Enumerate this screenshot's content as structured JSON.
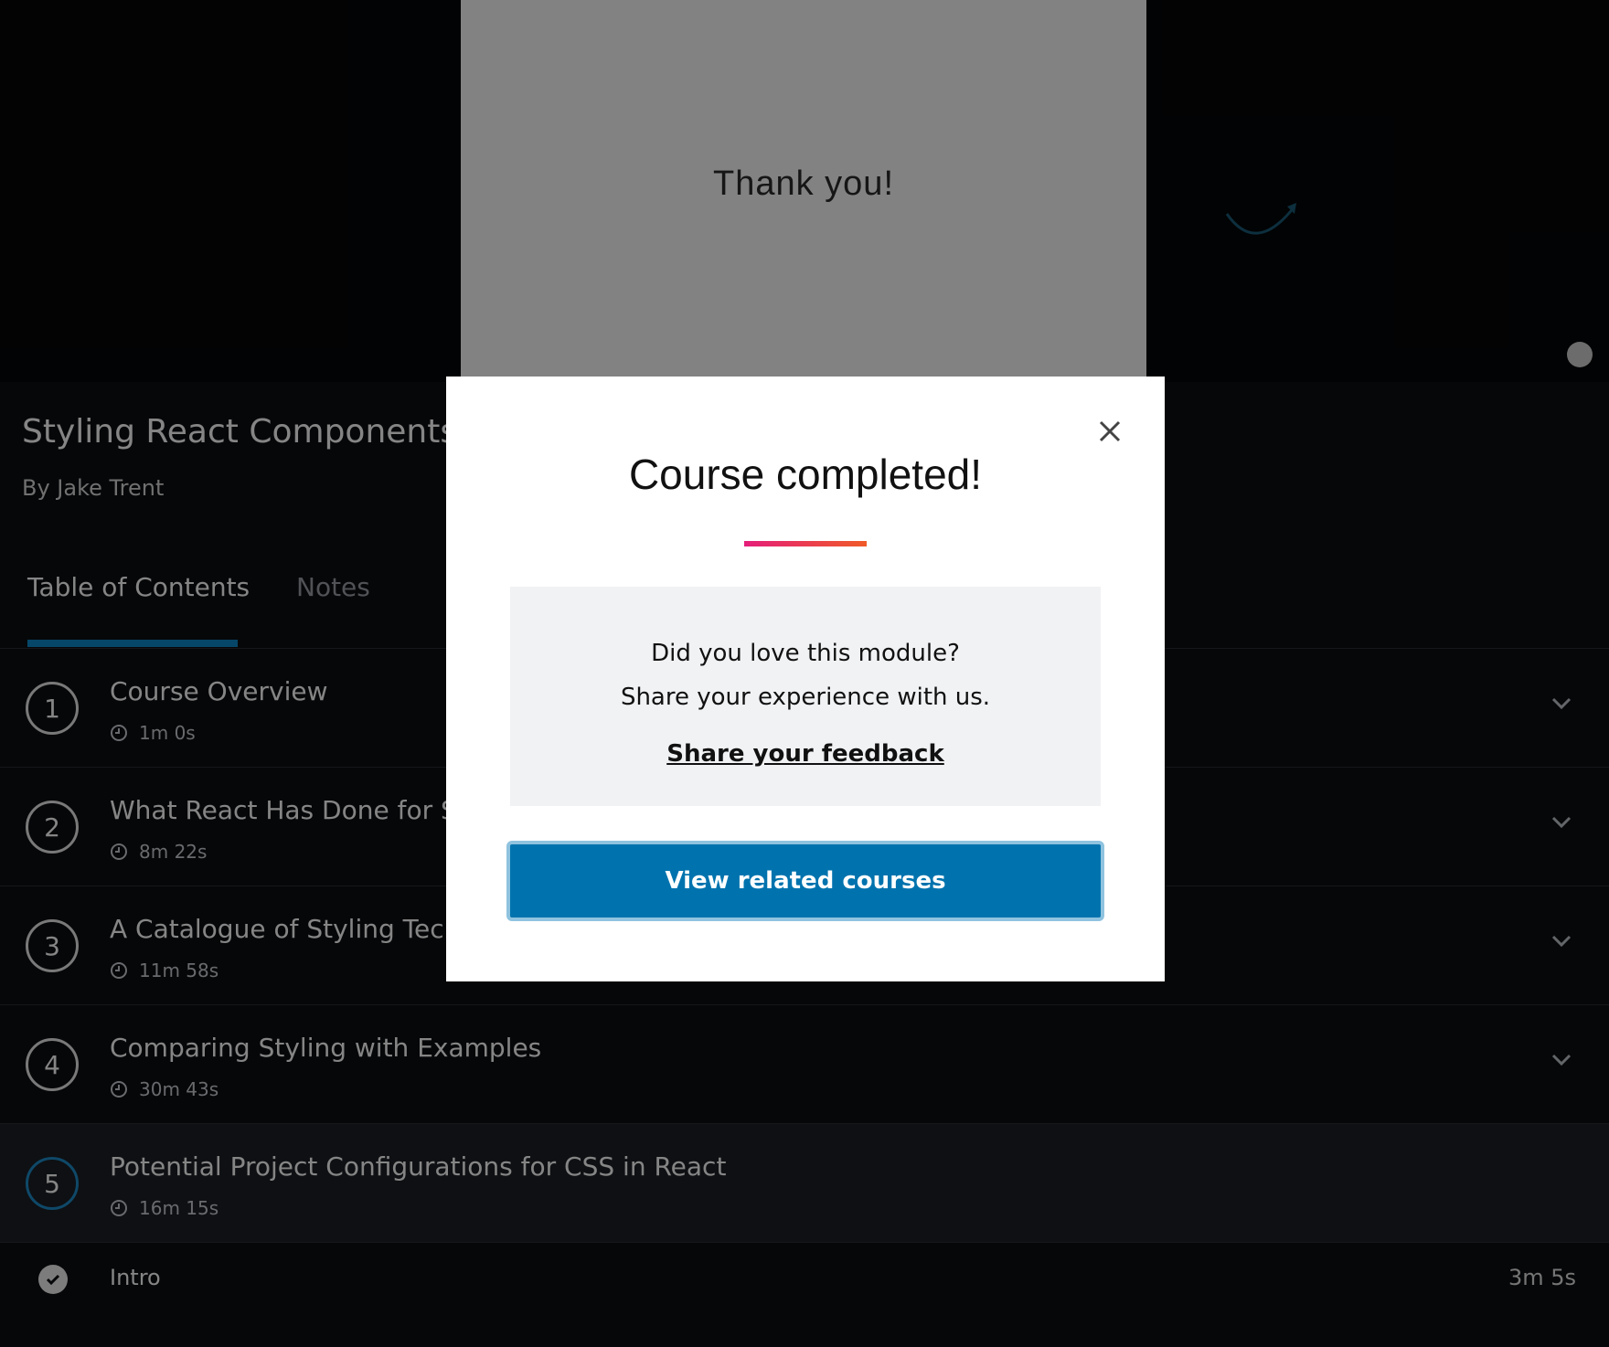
{
  "video": {
    "thanks_text": "Thank you!"
  },
  "course": {
    "title": "Styling React Components",
    "author": "By Jake Trent"
  },
  "tabs": [
    {
      "label": "Table of Contents",
      "active": true
    },
    {
      "label": "Notes",
      "active": false
    }
  ],
  "modules": [
    {
      "number": "1",
      "title": "Course Overview",
      "duration": "1m 0s",
      "active": false
    },
    {
      "number": "2",
      "title": "What React Has Done for St",
      "duration": "8m 22s",
      "active": false
    },
    {
      "number": "3",
      "title": "A Catalogue of Styling Tech",
      "duration": "11m 58s",
      "active": false
    },
    {
      "number": "4",
      "title": "Comparing Styling with Examples",
      "duration": "30m 43s",
      "active": false
    },
    {
      "number": "5",
      "title": "Potential Project Configurations for CSS in React",
      "duration": "16m 15s",
      "active": true
    }
  ],
  "clips": [
    {
      "title": "Intro",
      "duration": "3m 5s",
      "completed": true
    }
  ],
  "modal": {
    "title": "Course completed!",
    "question": "Did you love this module?",
    "share_text": "Share your experience with us.",
    "feedback_link": "Share your feedback",
    "related_button": "View related courses"
  },
  "colors": {
    "accent_blue": "#0073ae",
    "tab_underline": "#0d89c9",
    "gradient_start": "#e51e7a",
    "gradient_end": "#f05a28"
  },
  "icons": {
    "close": "close-icon",
    "chevron": "chevron-down-icon",
    "clock": "clock-icon",
    "check": "check-circle-icon",
    "play_badge": "play-badge-icon"
  }
}
